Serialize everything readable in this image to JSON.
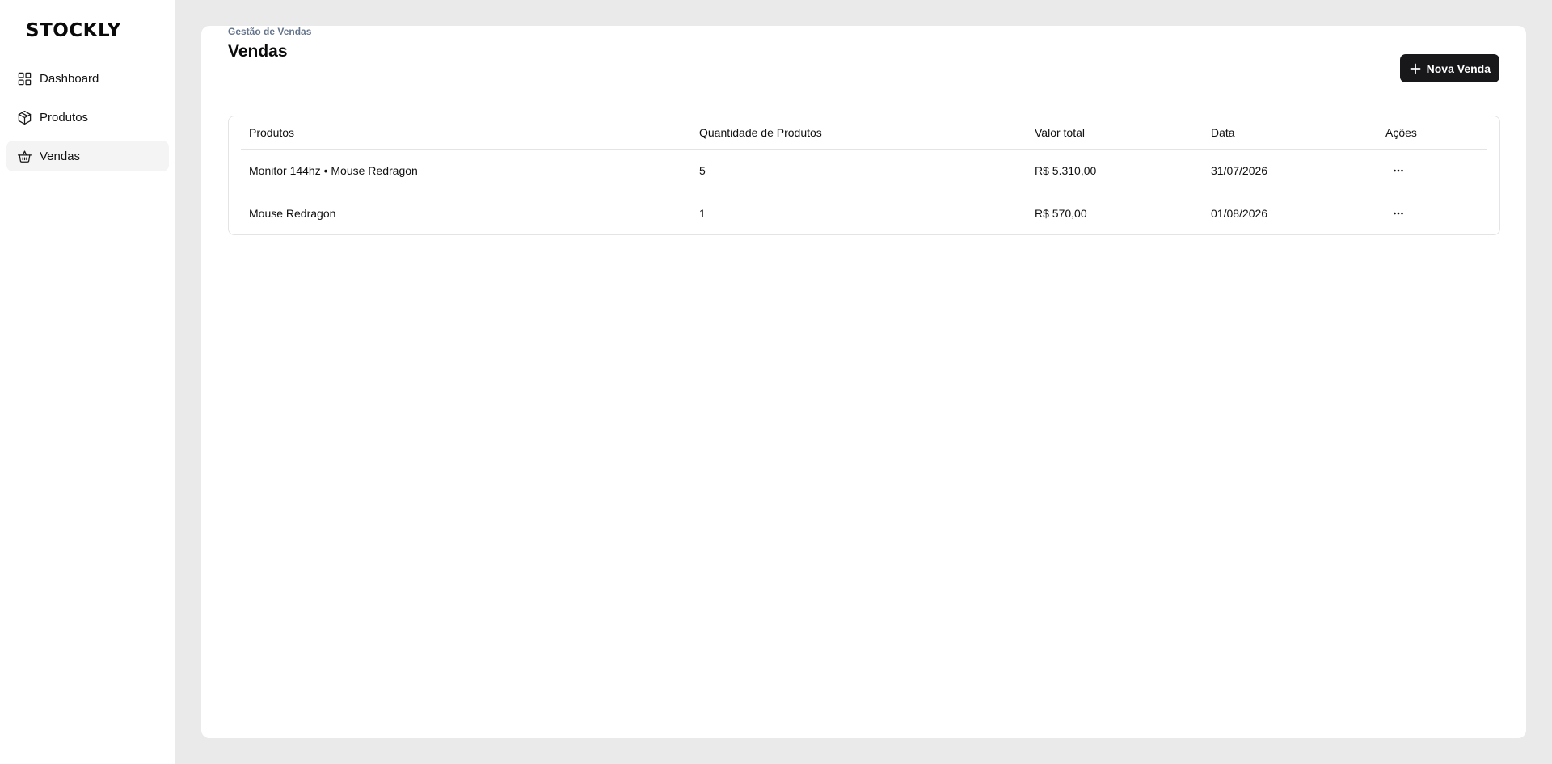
{
  "sidebar": {
    "logo": "STOCKLY",
    "items": [
      {
        "label": "Dashboard",
        "icon": "layout-grid-icon",
        "active": false
      },
      {
        "label": "Produtos",
        "icon": "package-icon",
        "active": false
      },
      {
        "label": "Vendas",
        "icon": "shopping-basket-icon",
        "active": true
      }
    ]
  },
  "header": {
    "breadcrumb": "Gestão de Vendas",
    "title": "Vendas",
    "new_button_label": "Nova Venda",
    "new_button_icon": "plus-icon"
  },
  "table": {
    "columns": [
      "Produtos",
      "Quantidade de Produtos",
      "Valor total",
      "Data",
      "Ações"
    ],
    "rows": [
      {
        "produtos": "Monitor 144hz • Mouse Redragon",
        "quantidade": "5",
        "valor": "R$ 5.310,00",
        "data": "31/07/2026"
      },
      {
        "produtos": "Mouse Redragon",
        "quantidade": "1",
        "valor": "R$ 570,00",
        "data": "01/08/2026"
      }
    ]
  },
  "colors": {
    "accent": "#18181b",
    "background": "#eaeaea",
    "card": "#ffffff",
    "active_nav": "#f4f4f5",
    "muted_text": "#64748b"
  }
}
